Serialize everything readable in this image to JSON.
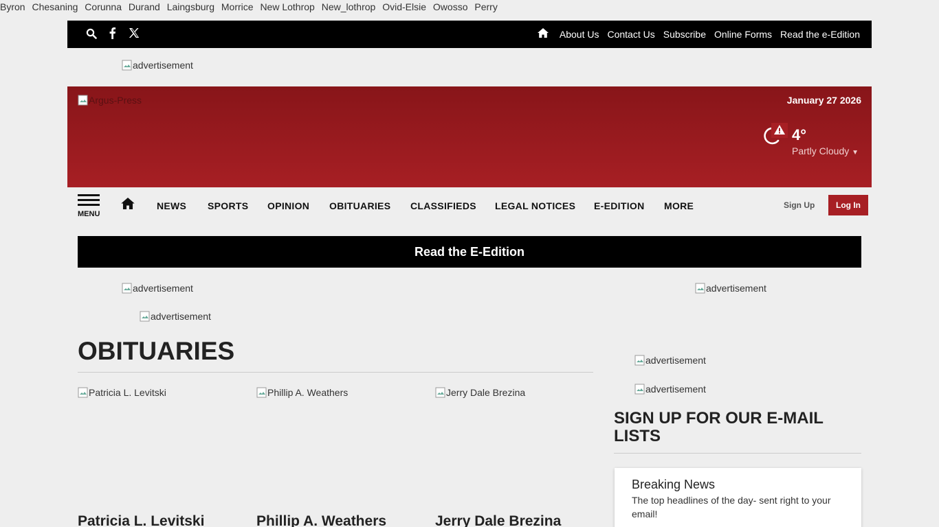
{
  "towns": [
    "Byron",
    "Chesaning",
    "Corunna",
    "Durand",
    "Laingsburg",
    "Morrice",
    "New Lothrop",
    "New_lothrop",
    "Ovid-Elsie",
    "Owosso",
    "Perry"
  ],
  "topbar": {
    "icons": [
      "search-icon",
      "facebook-icon",
      "x-icon",
      "home-icon"
    ],
    "links": [
      "About Us",
      "Contact Us",
      "Subscribe",
      "Online Forms",
      "Read the e-Edition"
    ]
  },
  "ads": {
    "alt": "advertisement"
  },
  "masthead": {
    "logo_alt": "Argus-Press",
    "date": "January 27 2026",
    "weather": {
      "temp": "4°",
      "condition": "Partly Cloudy"
    }
  },
  "nav": {
    "menu_label": "MENU",
    "items": [
      "NEWS",
      "SPORTS",
      "OPINION",
      "OBITUARIES",
      "CLASSIFIEDS",
      "LEGAL NOTICES",
      "E-EDITION",
      "MORE"
    ],
    "signup": "Sign Up",
    "login": "Log In"
  },
  "eedition_banner": "Read the E-Edition",
  "section": {
    "title": "OBITUARIES",
    "cards": [
      {
        "img_alt": "Patricia L. Levitski",
        "name": "Patricia L. Levitski"
      },
      {
        "img_alt": "Phillip A. Weathers",
        "name": "Phillip A. Weathers"
      },
      {
        "img_alt": "Jerry Dale Brezina",
        "name": "Jerry Dale Brezina"
      }
    ]
  },
  "sidebar": {
    "email_heading": "SIGN UP FOR OUR E-MAIL LISTS",
    "newsletter": {
      "title": "Breaking News",
      "description": "The top headlines of the day- sent right to your email!"
    }
  },
  "colors": {
    "brand_red": "#a71f24",
    "bar_black": "#000000",
    "background": "#eeeeee"
  }
}
